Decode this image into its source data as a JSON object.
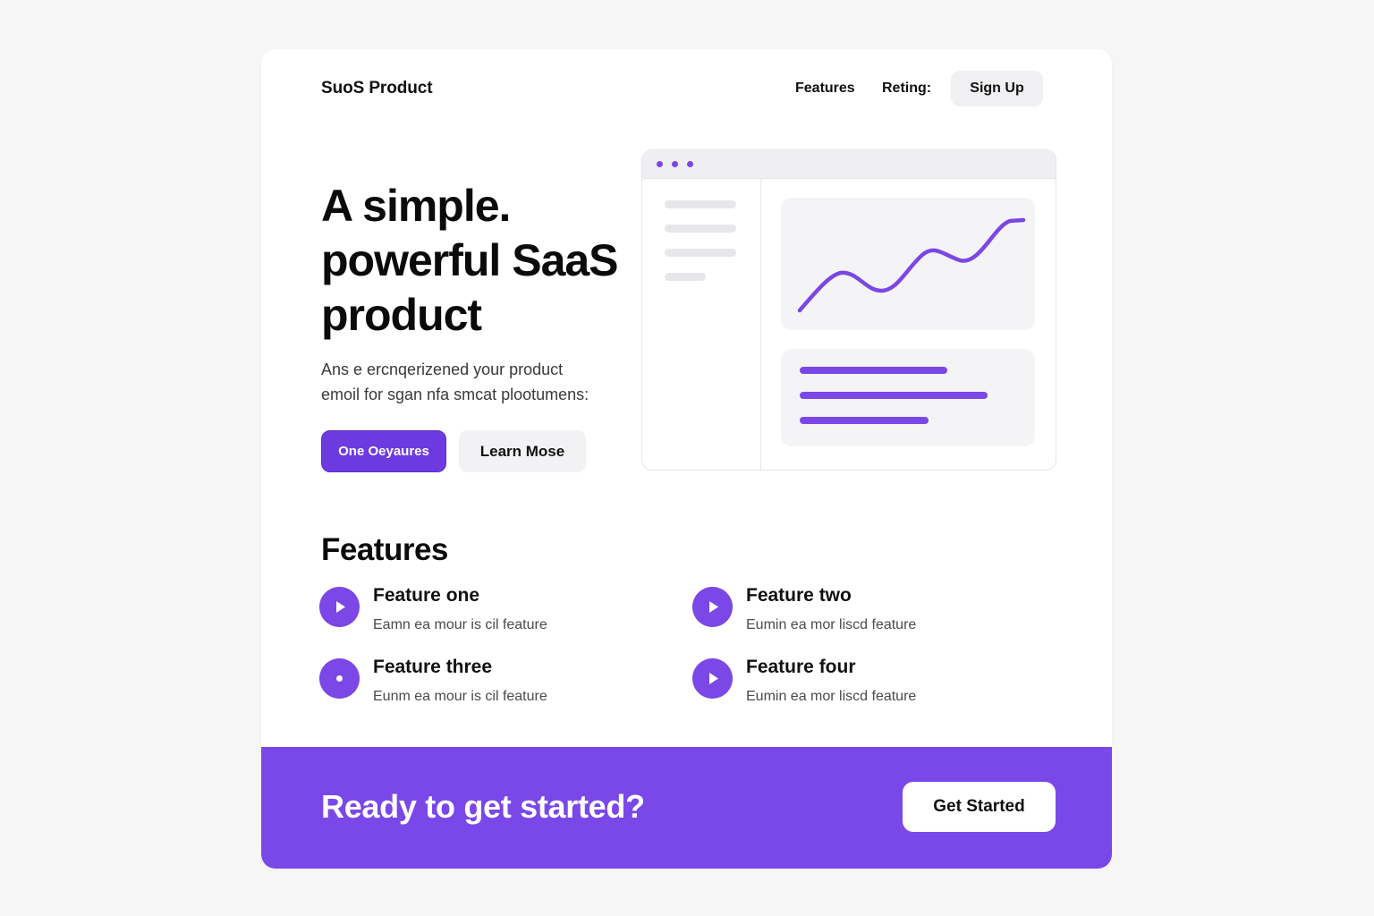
{
  "header": {
    "brand": "SuoS Product",
    "nav": [
      "Features",
      "Reting:"
    ],
    "signup_label": "Sign Up"
  },
  "hero": {
    "title_lines": [
      "A simple.",
      "powerful SaaS",
      "product"
    ],
    "subtitle_lines": [
      "Ans e ercnqerizened your product",
      "emoil for sgan nfa smcat plootumens:"
    ],
    "primary_label": "One Oeyaures",
    "secondary_label": "Learn Mose"
  },
  "features": {
    "title": "Features",
    "items": [
      {
        "title": "Feature one",
        "description": "Eamn ea mour is cil feature",
        "icon": "play-icon"
      },
      {
        "title": "Feature two",
        "description": "Eumin ea mor liscd feature",
        "icon": "play-icon"
      },
      {
        "title": "Feature three",
        "description": "Eunm ea mour is cil feature",
        "icon": "dot-icon"
      },
      {
        "title": "Feature four",
        "description": "Eumin ea mor liscd feature",
        "icon": "play-icon"
      }
    ]
  },
  "cta": {
    "text": "Ready to get started?",
    "button_label": "Get Started"
  },
  "colors": {
    "accent": "#7b47e6",
    "page_bg": "#f6f6f7",
    "panel_bg": "#f4f4f6"
  }
}
